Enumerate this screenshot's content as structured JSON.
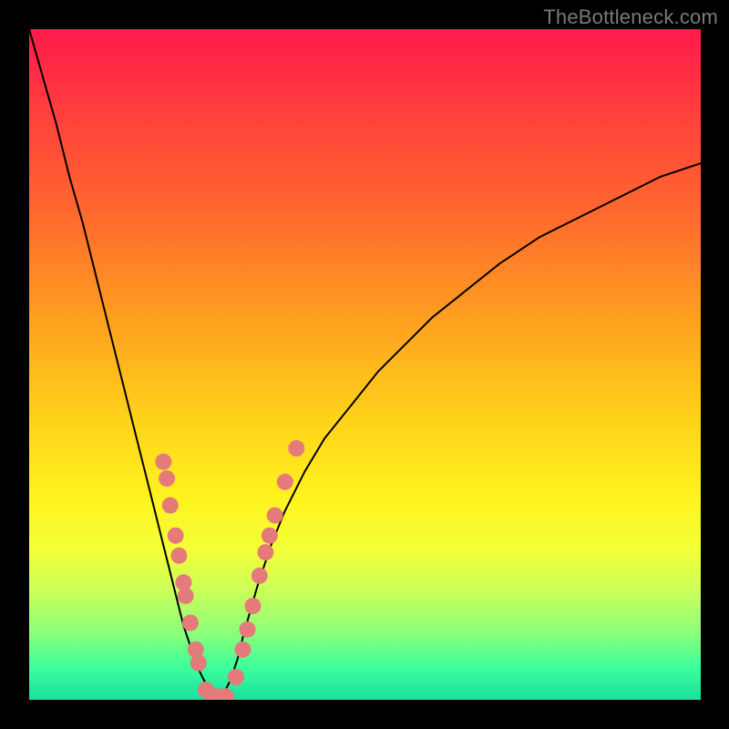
{
  "meta": {
    "watermark": "TheBottleneck.com",
    "domain": "Chart"
  },
  "chart_data": {
    "type": "line",
    "title": "",
    "xlabel": "",
    "ylabel": "",
    "xlim": [
      0,
      100
    ],
    "ylim": [
      0,
      100
    ],
    "annotations": [],
    "legend": false,
    "background_gradient": [
      "#ff1a4b",
      "#ff6a2d",
      "#ffd21a",
      "#fff31f",
      "#8cff7a",
      "#18e0a0"
    ],
    "series": [
      {
        "name": "bottleneck-curve-left",
        "x": [
          0,
          2,
          4,
          6,
          8,
          10,
          12,
          14,
          16,
          18,
          20,
          21,
          22,
          23,
          24,
          25,
          26,
          27,
          28
        ],
        "y": [
          100,
          93,
          86,
          78,
          71,
          63,
          55,
          47,
          39,
          31,
          23,
          19,
          15,
          11,
          8,
          5,
          3,
          1.2,
          0
        ]
      },
      {
        "name": "bottleneck-curve-right",
        "x": [
          28,
          29,
          30,
          31,
          32,
          34,
          36,
          38,
          41,
          44,
          48,
          52,
          56,
          60,
          65,
          70,
          76,
          82,
          88,
          94,
          100
        ],
        "y": [
          0,
          1,
          3,
          6,
          10,
          17,
          23,
          28,
          34,
          39,
          44,
          49,
          53,
          57,
          61,
          65,
          69,
          72,
          75,
          78,
          80
        ]
      }
    ],
    "markers": {
      "name": "highlight-dots",
      "color": "#e47a7a",
      "points": [
        {
          "x": 20.0,
          "y": 35.5
        },
        {
          "x": 20.5,
          "y": 33.0
        },
        {
          "x": 21.0,
          "y": 29.0
        },
        {
          "x": 21.8,
          "y": 24.5
        },
        {
          "x": 22.3,
          "y": 21.5
        },
        {
          "x": 23.0,
          "y": 17.5
        },
        {
          "x": 23.3,
          "y": 15.5
        },
        {
          "x": 24.0,
          "y": 11.5
        },
        {
          "x": 24.8,
          "y": 7.5
        },
        {
          "x": 25.2,
          "y": 5.5
        },
        {
          "x": 26.3,
          "y": 1.5
        },
        {
          "x": 27.3,
          "y": 0.5
        },
        {
          "x": 28.2,
          "y": 0.5
        },
        {
          "x": 29.3,
          "y": 0.5
        },
        {
          "x": 30.8,
          "y": 3.4
        },
        {
          "x": 31.8,
          "y": 7.5
        },
        {
          "x": 32.5,
          "y": 10.5
        },
        {
          "x": 33.3,
          "y": 14.0
        },
        {
          "x": 34.3,
          "y": 18.5
        },
        {
          "x": 35.2,
          "y": 22.0
        },
        {
          "x": 35.8,
          "y": 24.5
        },
        {
          "x": 36.6,
          "y": 27.5
        },
        {
          "x": 38.1,
          "y": 32.5
        },
        {
          "x": 39.8,
          "y": 37.5
        }
      ]
    }
  }
}
